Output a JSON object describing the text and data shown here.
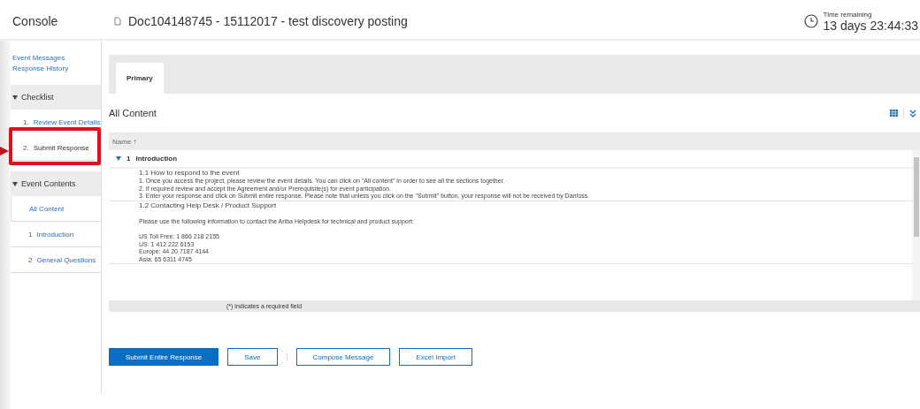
{
  "header": {
    "console": "Console",
    "title": "Doc104148745 - 15112017 - test discovery posting",
    "time_label": "Time remaining",
    "time_value": "13 days 23:44:33"
  },
  "sidebar": {
    "links": [
      "Event Messages",
      "Response History"
    ],
    "checklist": {
      "title": "Checklist",
      "expanded": true,
      "items": [
        {
          "number": "1.",
          "label": "Review Event Details",
          "highlighted": false
        },
        {
          "number": "2.",
          "label": "Submit Response",
          "highlighted": true
        }
      ]
    },
    "event_contents": {
      "title": "Event Contents",
      "expanded": true,
      "items": [
        {
          "label": "All Content",
          "selected": true
        },
        {
          "number": "1",
          "label": "Introduction",
          "selected": false
        },
        {
          "number": "2",
          "label": "General Questions",
          "selected": false
        }
      ]
    }
  },
  "tabs": [
    {
      "label": "Primary",
      "selected": true
    }
  ],
  "content": {
    "title": "All Content",
    "column": "Name ↑",
    "section": {
      "number": "1",
      "title": "Introduction",
      "expanded": true
    },
    "blocks": [
      {
        "heading": "1.1   How to respond to the event",
        "paragraphs": [
          [
            "1. Once you access the project, please review the event details. You can click on \"All content\" in order to see all the sections together.",
            "2. If required review and accept the Agreement and/or Prerequisite(s) for event participation.",
            "3. Enter your response and click on Submit entire response. Please note that unless you click on the \"Submit\" button, your response will not be received by Danfoss."
          ]
        ]
      },
      {
        "heading": "1.2   Contacting Help Desk / Product Support",
        "paragraphs": [
          [
            "Please use the following information to contact the Ariba Helpdesk for technical and product support:"
          ],
          [
            "US Toll Free: 1 866 218 2155",
            "US: 1 412 222 6153",
            "Europe: 44 20 7187 4144",
            "Asia: 65 6311 4745"
          ]
        ]
      }
    ],
    "footer": "(*) indicates a required field"
  },
  "buttons": [
    {
      "label": "Submit Entire Response",
      "kind": "primary"
    },
    {
      "label": "Save",
      "kind": "secondary"
    },
    {
      "label": "Compose Message",
      "kind": "secondary"
    },
    {
      "label": "Excel Import",
      "kind": "secondary"
    }
  ]
}
